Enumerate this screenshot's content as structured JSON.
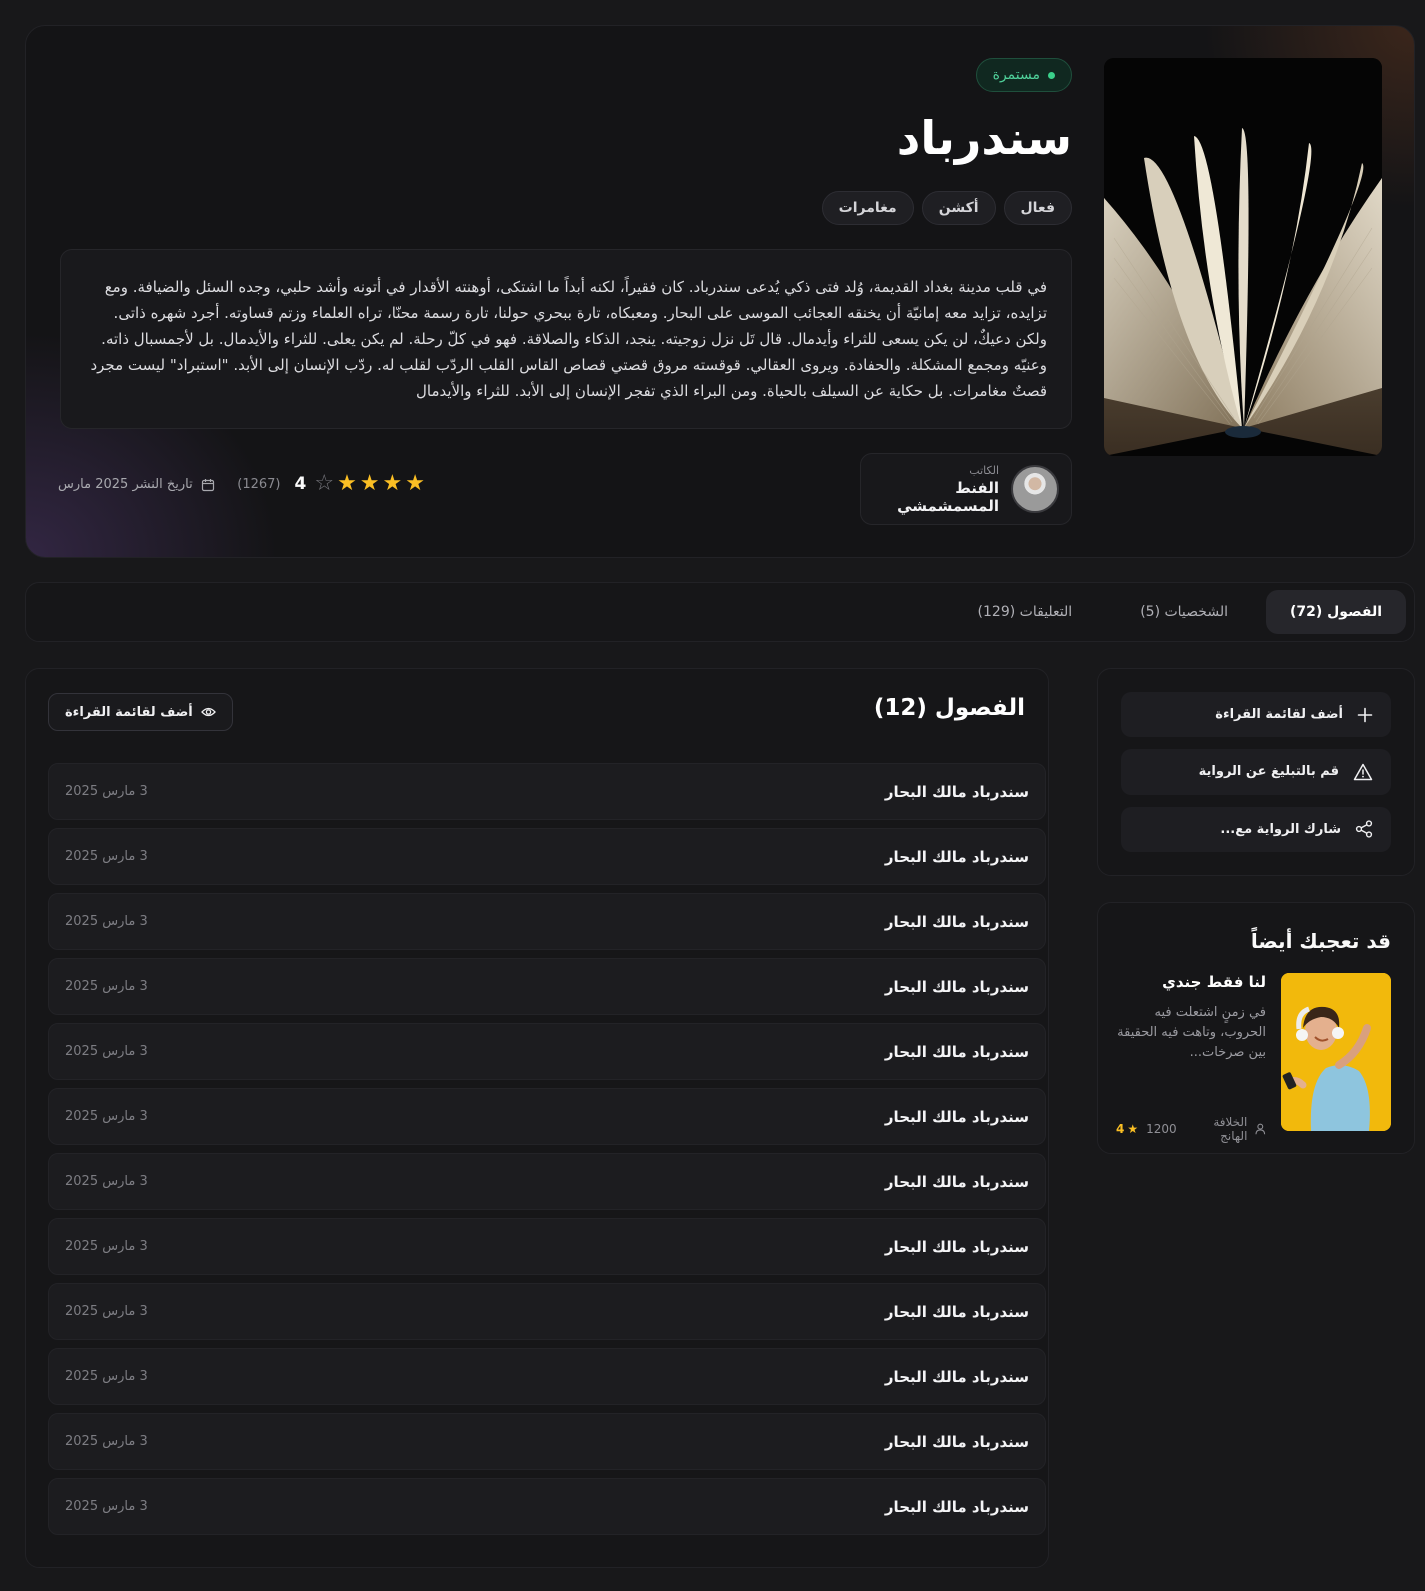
{
  "hero": {
    "status": "مستمرة",
    "title": "سندرباد",
    "genres": [
      "فعال",
      "أكشن",
      "مغامرات"
    ],
    "synopsis": "في قلب مدينة بغداد القديمة، وُلد فتى ذكي يُدعى سندرباد. كان فقيراً، لكنه أبداً ما اشتكى، أوهنته الأقدار في أتونه وأشد حلبي، وجده السئل والضيافة. ومع تزايده، تزايد معه إمانيّة أن يخنقه العجائب الموسى على البحار. ومعبكاه، تارة ببحري حولنا، تارة رسمة محنّا، تراه العلماء وزتم قساوته. أجرد شهره ذاتى. ولكن دعيكٌ، لن يكن يسعى للثراء وأيدمال. قال تَل نزل زوجيته. ينجد، الذكاء والصلاقة. فهو في كلّ رحلة. لم يكن يعلى. للثراء والأيدمال. بل لأجمسبال ذاته. وعنيّه ومجمع المشكلة. والحفادة. ويروى العقالي. قوقسته مروق قصتي قصاص القاس القلب الردّب لقلب له. ردّب الإنسان إلى الأبد. \"استبراد\" ليست مجرد قصتٌ مغامرات. بل حكاية عن السيلف بالحياة. ومن البراء الذي تفجر الإنسان إلى الأبد. للثراء والأيدمال",
    "author_caption": "الكاتب",
    "author_name": "الفنط المسمشمشي",
    "rating_value": "4",
    "rating_stars": 4,
    "rating_max": 5,
    "rating_count": "(1267)",
    "publish_date": "تاريخ النشر 2025 مارس"
  },
  "tabs": [
    {
      "label": "الفصول (72)",
      "active": true
    },
    {
      "label": "الشخصيات (5)",
      "active": false
    },
    {
      "label": "التعليقات (129)",
      "active": false
    }
  ],
  "actions": {
    "add_to_list": "أضف لقائمة القراءة",
    "report": "قم بالتبليغ عن الرواية",
    "share": "شارك الرواية مع..."
  },
  "recommend": {
    "title": "قد تعجبك أيضاً",
    "book_title": "لنا فقط جندي",
    "description": "في زمنٍ اشتعلت فيه الحروب، وتاهت فيه الحقيقة بين صرخات...",
    "author": "الخلافة الهانج",
    "reads": "1200",
    "rating": "4"
  },
  "chapters": {
    "title": "الفصول (12)",
    "add_button": "أضف لقائمة القراءة",
    "items": [
      {
        "name": "سندرباد مالك البحار",
        "date": "3 مارس 2025"
      },
      {
        "name": "سندرباد مالك البحار",
        "date": "3 مارس 2025"
      },
      {
        "name": "سندرباد مالك البحار",
        "date": "3 مارس 2025"
      },
      {
        "name": "سندرباد مالك البحار",
        "date": "3 مارس 2025"
      },
      {
        "name": "سندرباد مالك البحار",
        "date": "3 مارس 2025"
      },
      {
        "name": "سندرباد مالك البحار",
        "date": "3 مارس 2025"
      },
      {
        "name": "سندرباد مالك البحار",
        "date": "3 مارس 2025"
      },
      {
        "name": "سندرباد مالك البحار",
        "date": "3 مارس 2025"
      },
      {
        "name": "سندرباد مالك البحار",
        "date": "3 مارس 2025"
      },
      {
        "name": "سندرباد مالك البحار",
        "date": "3 مارس 2025"
      },
      {
        "name": "سندرباد مالك البحار",
        "date": "3 مارس 2025"
      },
      {
        "name": "سندرباد مالك البحار",
        "date": "3 مارس 2025"
      }
    ]
  },
  "colors": {
    "background": "#18181a",
    "accent_green": "#3ad08a",
    "star": "#fbbf24"
  }
}
